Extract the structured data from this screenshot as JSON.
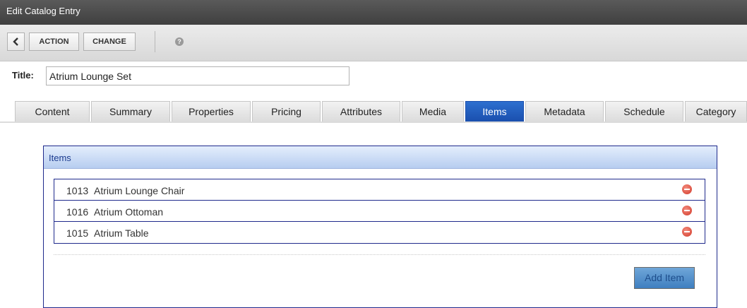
{
  "window": {
    "title": "Edit Catalog Entry"
  },
  "toolbar": {
    "back_icon": "chevron-left-icon",
    "action_label": "ACTION",
    "change_label": "CHANGE",
    "help_icon": "help-icon",
    "help_glyph": "?"
  },
  "form": {
    "title_label": "Title:",
    "title_value": "Atrium Lounge Set"
  },
  "tabs": [
    {
      "label": "Content"
    },
    {
      "label": "Summary"
    },
    {
      "label": "Properties"
    },
    {
      "label": "Pricing"
    },
    {
      "label": "Attributes"
    },
    {
      "label": "Media"
    },
    {
      "label": "Items",
      "active": true
    },
    {
      "label": "Metadata"
    },
    {
      "label": "Schedule"
    },
    {
      "label": "Category"
    }
  ],
  "items_panel": {
    "header": "Items",
    "rows": [
      {
        "id": "1013",
        "name": "Atrium Lounge Chair",
        "icon": "remove-icon"
      },
      {
        "id": "1016",
        "name": "Atrium Ottoman",
        "icon": "remove-icon"
      },
      {
        "id": "1015",
        "name": "Atrium Table",
        "icon": "remove-icon"
      }
    ],
    "add_label": "Add Item"
  },
  "colors": {
    "titlebar": "#4a4a4a",
    "active_tab": "#1f5bbe",
    "panel_border": "#1f2a8c",
    "remove_icon": "#d9412f",
    "add_button": "#4f8fcb"
  }
}
